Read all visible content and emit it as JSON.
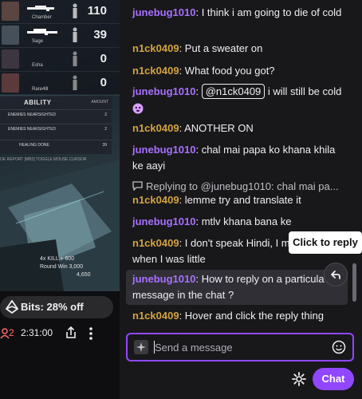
{
  "scoreboard": {
    "players": [
      {
        "name": "Chamber",
        "score": "110"
      },
      {
        "name": "Sage",
        "score": "39"
      },
      {
        "name": "Esha",
        "score": "0"
      },
      {
        "name": "Rare4lll",
        "score": "0"
      }
    ]
  },
  "ability": {
    "title": "ABILITY",
    "amount_header": "AMOUNT",
    "rows": [
      {
        "label": "ENEMIES NEARSIGHTED",
        "value": "2"
      },
      {
        "label": "ENEMIES NEARSIGHTED",
        "value": "2"
      },
      {
        "label": "HEALING DONE",
        "value": "39"
      }
    ]
  },
  "game_footer": "OE REPORT  [MB3] TOGGLE MOUSE CURSOR",
  "killfeed": {
    "kill": "4x KILL  + 600",
    "round_win": "Round Win  3,000",
    "total": "4,650"
  },
  "bits": {
    "label": "Bits: 28% off"
  },
  "stream": {
    "viewers": "2",
    "uptime": "2:31:00"
  },
  "chat": {
    "messages": [
      {
        "user": "junebug1010",
        "text": "I think i am going to die of cold"
      },
      {
        "user": "n1ck0409",
        "text": "Put a sweater on"
      },
      {
        "user": "n1ck0409",
        "text": "What food you got?"
      },
      {
        "user": "junebug1010",
        "mention": "@n1ck0409",
        "text": " i will still be cold"
      },
      {
        "user": "n1ck0409",
        "text": "ANOTHER ON"
      },
      {
        "user": "junebug1010",
        "text": "chal mai papa ko khana khila ke aayi"
      },
      {
        "user": "n1ck0409",
        "text": "lemme try and translate it"
      },
      {
        "user": "junebug1010",
        "text": "mtlv khana bana ke"
      },
      {
        "user": "n1ck0409",
        "text": "I don't speak Hindi, I m"
      },
      {
        "user": "junebug1010",
        "text": "How to reply on a particula"
      },
      {
        "user": "n1ck0409",
        "text": "Hover and click the reply thing"
      }
    ],
    "msg8_line2": "when I was little",
    "msg9_line2": "message in the chat ?",
    "reply_context": "Replying to @junebug1010: chal mai pa...",
    "tooltip": "Click to reply",
    "input_placeholder": "Send a message",
    "send_label": "Chat"
  },
  "colors": {
    "accent": "#9147ff",
    "user_purple": "#a970ff",
    "user_gold": "#d4a340"
  }
}
